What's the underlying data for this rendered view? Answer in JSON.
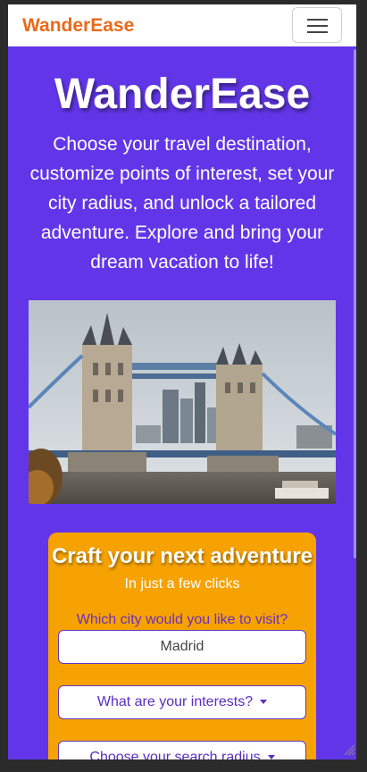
{
  "nav": {
    "brand": "WanderEase"
  },
  "hero": {
    "title": "WanderEase",
    "description": "Choose your travel destination, customize points of interest, set your city radius, and unlock a tailored adventure. Explore and bring your dream vacation to life!"
  },
  "card": {
    "title": "Craft your next adventure",
    "subtitle": "In just a few clicks",
    "city_label": "Which city would you like to visit?",
    "city_value": "Madrid",
    "interests_label": "What are your interests?",
    "radius_label": "Choose your search radius"
  },
  "colors": {
    "background": "#6236e8",
    "brand": "#ea6a19",
    "card": "#f7a203",
    "accent_text": "#6a2fc3"
  },
  "icons": {
    "menu": "hamburger-menu-icon",
    "dropdown": "caret-down-icon"
  }
}
